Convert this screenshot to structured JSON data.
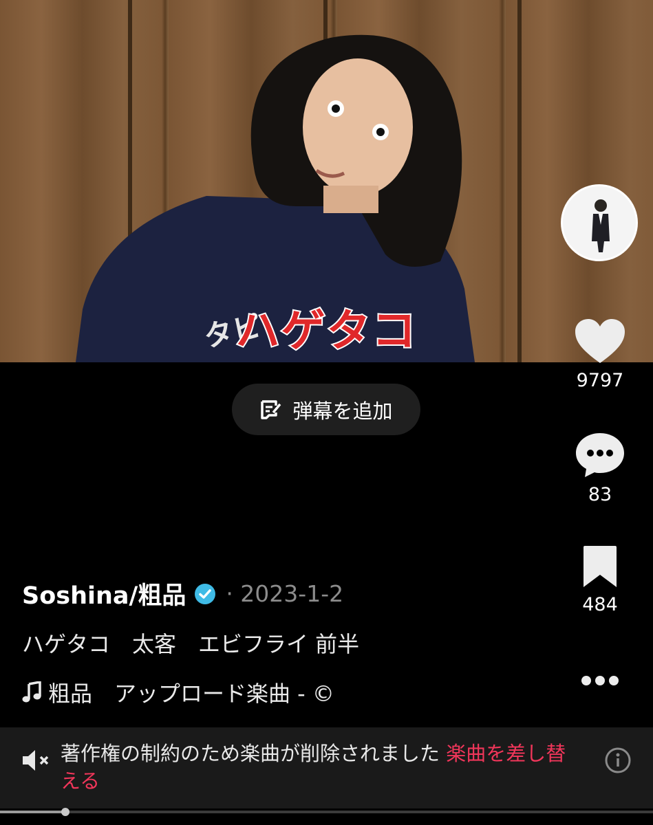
{
  "video": {
    "caption": "ハゲタコ"
  },
  "sidebar": {
    "likes": "9797",
    "comments": "83",
    "saves": "484"
  },
  "danmaku": {
    "label": "弾幕を追加"
  },
  "post": {
    "author": "Soshina/粗品",
    "date": "· 2023-1-2",
    "description": "ハゲタコ　太客　エビフライ 前半",
    "music": "粗品　アップロード楽曲 - ©"
  },
  "notice": {
    "text": "著作権の制約のため楽曲が削除されました ",
    "link": "楽曲を差し替える"
  },
  "progress": {
    "fraction": 0.1
  },
  "colors": {
    "background": "#000000",
    "accent_link": "#f0365a",
    "verified": "#3fbbe6",
    "caption_red": "#e0282a"
  },
  "icons": [
    "heart-icon",
    "comment-icon",
    "bookmark-icon",
    "more-icon",
    "danmaku-icon",
    "verified-badge-icon",
    "music-note-icon",
    "muted-speaker-icon",
    "info-icon"
  ]
}
